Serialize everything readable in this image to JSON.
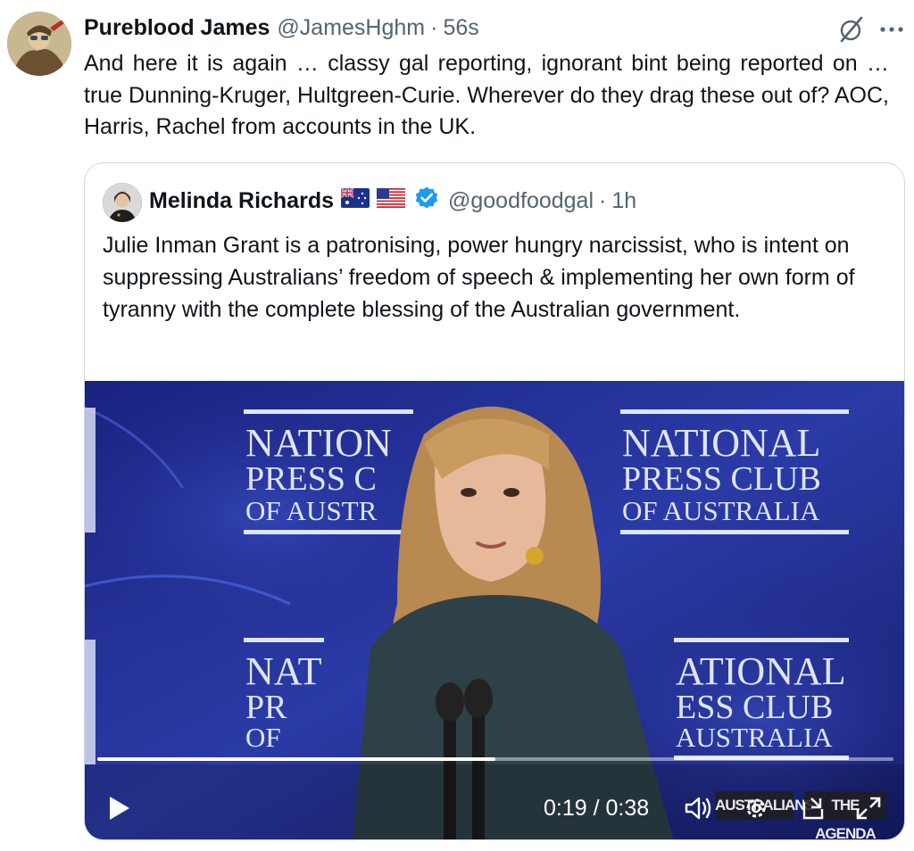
{
  "tweet": {
    "author_name": "Pureblood James",
    "author_handle": "@JamesHghm",
    "separator": "·",
    "time": "56s",
    "text": "And here it is again … classy gal reporting, ignorant bint being reported on … true Dunning-Kruger, Hultgreen-Curie. Wherever do they drag these out of? AOC, Harris, Rachel from accounts in the UK."
  },
  "actions": {
    "grok_icon": "grok-slash-icon",
    "more_icon": "more-dots-icon"
  },
  "quote": {
    "author_name": "Melinda Richards",
    "flags": [
      "australia-flag",
      "us-flag"
    ],
    "verified": true,
    "author_handle": "@goodfoodgal",
    "separator": "·",
    "time": "1h",
    "text": "Julie Inman Grant is a patronising, power hungry narcissist, who is intent on suppressing Australians’ freedom of speech & implementing her own form of tyranny with the complete blessing of the Australian government."
  },
  "video": {
    "backdrop_signs": [
      {
        "line1": "NATION",
        "line2": "PRESS C",
        "line3": "OF AUSTR"
      },
      {
        "line1": "NATIONAL",
        "line2": "PRESS CLUB",
        "line3": "OF AUSTRALIA"
      },
      {
        "line1": "NAT",
        "line2": "PR",
        "line3": "OF"
      },
      {
        "line1": "ATIONAL",
        "line2": "ESS CLUB",
        "line3": "AUSTRALIA"
      }
    ],
    "current_time": "0:19",
    "time_separator": "/",
    "duration": "0:38",
    "progress_fraction": 0.5,
    "watermark_left": "AUSTRALIANS",
    "watermark_right": "THE AGENDA",
    "colors": {
      "stage": "#2236a0",
      "sign_text": "#dfe4ff"
    }
  }
}
